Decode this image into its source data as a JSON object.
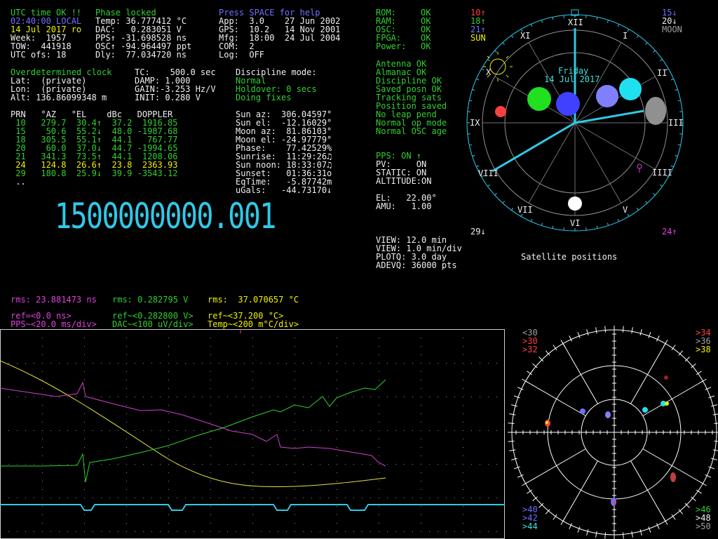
{
  "status": {
    "utc": "UTC time OK !!",
    "phase": "Phase locked",
    "help": "Press SPACE for help",
    "time_local": "02:40:00 LOCAL",
    "date": "14 Jul 2017 ro",
    "week": "Week:  1957",
    "tow": "TOW:  441918",
    "utc_ofs": "UTC ofs: 18"
  },
  "readings": {
    "temp": "Temp: 36.777412 °C",
    "dac": "DAC:   0.283051 V",
    "pps": "PPS↑ -31.698528 ns",
    "osc": "OSC↑ -94.964497 ppt",
    "dly": "Dly:  77.034720 ns"
  },
  "versions": {
    "app": "App:  3.0    27 Jun 2002",
    "gps": "GPS:  10.2   14 Nov 2001",
    "mfg": "Mfg:  18:00  24 Jul 2004",
    "com": "COM:  2",
    "log": "Log:  OFF"
  },
  "selftest": [
    {
      "k": "ROM:   ",
      "v": "OK"
    },
    {
      "k": "RAM:   ",
      "v": "OK"
    },
    {
      "k": "OSC:   ",
      "v": "OK"
    },
    {
      "k": "FPGA:  ",
      "v": "OK"
    },
    {
      "k": "Power: ",
      "v": "OK"
    }
  ],
  "clock": {
    "mode": "Overdetermined clock",
    "lat": "Lat:  (private)",
    "lon": "Lon:  (private)",
    "alt": "Alt: 136.86099348 m",
    "tc": "TC:    500.0 sec",
    "damp": "DAMP: 1.000",
    "gain": "GAIN:-3.253 Hz/V",
    "init": "INIT: 0.280 V"
  },
  "discipline": {
    "label": "Discipline mode:",
    "mode": "Normal",
    "holdover": "Holdover: 0 secs",
    "fixes": "Doing fixes"
  },
  "receiver_status": [
    "Antenna OK",
    "Almanac OK",
    "Discipline OK",
    "Saved posn OK",
    "Tracking sats",
    "Position saved",
    "No leap pend",
    "Normal op mode",
    "Normal OSC age"
  ],
  "sat_table": {
    "header": "PRN   °AZ   °EL    dBc   DOPPLER",
    "rows": [
      {
        "line": " 10   279.7  30.4↑  37.2  1916.85",
        "color": "#30d030"
      },
      {
        "line": " 15    50.6  55.2↓  48.0 -1987.68",
        "color": "#30d030"
      },
      {
        "line": " 18   305.5  55.1↑  44.1   767.77",
        "color": "#30d030"
      },
      {
        "line": " 20    60.0  37.0↓  44.7 -1994.65",
        "color": "#30d030"
      },
      {
        "line": " 21   341.3  73.5↑  44.1  1208.06",
        "color": "#30d030"
      },
      {
        "line": " 24   124.8  26.6↑  23.8  2363.93",
        "color": "#f0f000"
      },
      {
        "line": " 29   180.8  25.9↓  39.9 -3543.12",
        "color": "#30d030"
      }
    ],
    "more": " .."
  },
  "astro": [
    "Sun az:  306.04597°",
    "Sun el:  -12.16029°",
    "Moon az:  81.86103°",
    "Moon el: -24.97779°",
    "Phase:    77.42529%",
    "Sunrise:  11:29:26♫",
    "Sun noon: 18:33:07♫",
    "Sunset:   01:36:31o",
    "EqTime:   -5.87742m",
    "uGals:   -44.73170↓"
  ],
  "pps": {
    "state": "PPS: ON ↑",
    "pv": "PV:     ON",
    "static": "STATIC: ON",
    "alt": "ALTITUDE:ON",
    "el": "EL:   22.00°",
    "amu": "AMU:   1.00"
  },
  "view": {
    "v1": "VIEW: 12.0 min",
    "v2": "VIEW: 1.0 min/div",
    "plotq": "PLOTQ: 3.0 day",
    "adevq": "ADEVQ: 36000 pts"
  },
  "frequency": "1500000000.001",
  "clockface": {
    "day": "Friday",
    "date": "14 Jul 2017",
    "caption": "Satellite positions",
    "numerals": [
      "XII",
      "I",
      "II",
      "III",
      "IIII",
      "V",
      "VI",
      "VII",
      "VIII",
      "IX",
      "X",
      "XI"
    ],
    "legend_left": [
      {
        "t": "10↑",
        "color": "#ff4040"
      },
      {
        "t": "18↑",
        "color": "#30d030"
      },
      {
        "t": "21↑",
        "color": "#7070ff"
      },
      {
        "t": "SUN",
        "color": "#f0f000"
      }
    ],
    "legend_right": [
      {
        "t": "15↓",
        "color": "#7070ff"
      },
      {
        "t": "20↓",
        "color": "#f0f0f0"
      },
      {
        "t": "MOON",
        "color": "#a0a0a0"
      }
    ],
    "bl": "29↓",
    "br": "24↑"
  },
  "rms": {
    "pps": "rms: 23.881473 ns",
    "dac": "rms: 0.282795 V",
    "temp": "rms:  37.070657 °C"
  },
  "refs": {
    "pps_ref": "ref=<0.0 ns>",
    "pps_scale": "PPS~<20.0 ms/div>",
    "dac_ref": "ref~<0.282800 V>",
    "dac_scale": "DAC~<100 uV/div>",
    "temp_ref": "ref~<37.200 °C>",
    "temp_scale": "Temp~<200 m°C/div>"
  },
  "skymap": {
    "tl": [
      {
        "t": "<30",
        "c": "#a0a0a0"
      },
      {
        "t": ">30",
        "c": "#ff4040"
      },
      {
        "t": ">32",
        "c": "#ff4040"
      }
    ],
    "tr": [
      {
        "t": ">34",
        "c": "#ff4040"
      },
      {
        "t": ">36",
        "c": "#a0a0a0"
      },
      {
        "t": ">38",
        "c": "#f0f000"
      }
    ],
    "bl": [
      {
        "t": ">40",
        "c": "#7070ff"
      },
      {
        "t": ">42",
        "c": "#7070ff"
      },
      {
        "t": ">44",
        "c": "#40e0e0"
      }
    ],
    "br": [
      {
        "t": ">46",
        "c": "#30d030"
      },
      {
        "t": ">48",
        "c": "#f0f0f0"
      },
      {
        "t": ">50",
        "c": "#a0a0a0"
      }
    ]
  }
}
